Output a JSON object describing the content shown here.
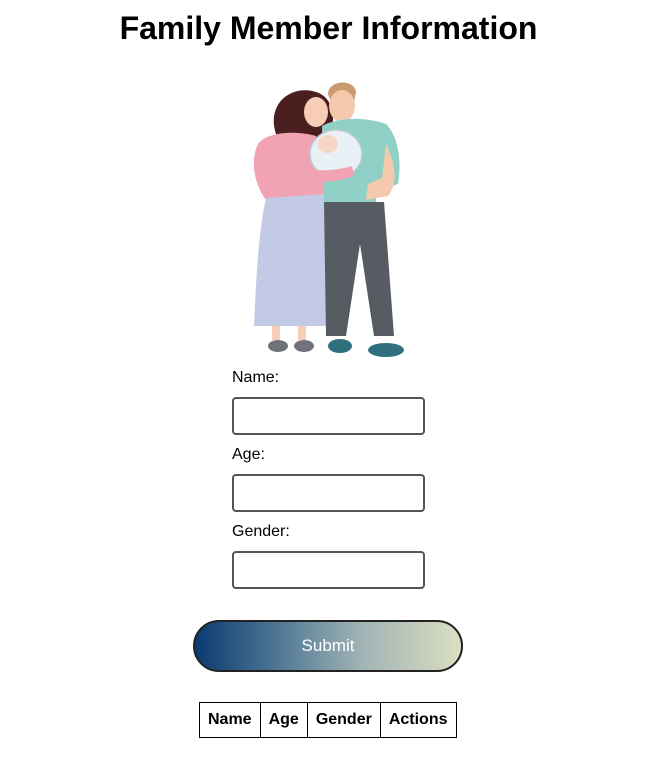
{
  "page": {
    "title": "Family Member Information"
  },
  "illustration": {
    "icon": "family-illustration"
  },
  "form": {
    "name_label": "Name:",
    "name_value": "",
    "age_label": "Age:",
    "age_value": "",
    "gender_label": "Gender:",
    "gender_value": "",
    "submit_label": "Submit"
  },
  "table": {
    "headers": [
      "Name",
      "Age",
      "Gender",
      "Actions"
    ],
    "rows": []
  },
  "colors": {
    "submit_gradient_start": "#0b3a73",
    "submit_gradient_end": "#dcdfc2",
    "input_border": "#555555"
  }
}
